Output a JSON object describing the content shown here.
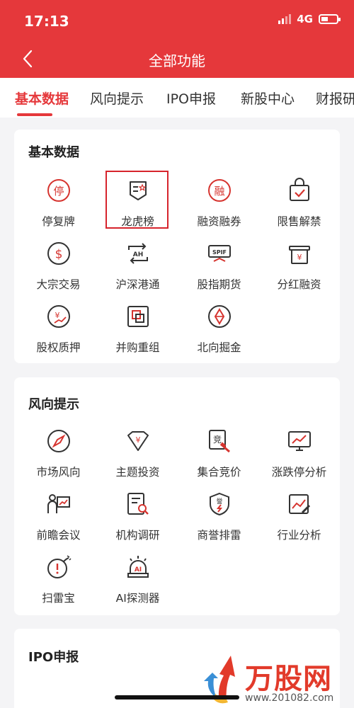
{
  "status_bar": {
    "time": "17:13",
    "network": "4G",
    "icons": [
      "signal-icon",
      "battery-icon"
    ]
  },
  "nav": {
    "back_icon": "back-arrow-icon",
    "title": "全部功能"
  },
  "tabs": [
    {
      "label": "基本数据",
      "active": true
    },
    {
      "label": "风向提示",
      "active": false
    },
    {
      "label": "IPO申报",
      "active": false
    },
    {
      "label": "新股中心",
      "active": false
    },
    {
      "label": "财报研",
      "active": false
    }
  ],
  "sections": {
    "basic": {
      "title": "基本数据",
      "items": [
        {
          "label": "停复牌",
          "icon": "suspension-icon"
        },
        {
          "label": "龙虎榜",
          "icon": "dragon-tiger-list-icon",
          "highlighted": true
        },
        {
          "label": "融资融券",
          "icon": "margin-trading-icon"
        },
        {
          "label": "限售解禁",
          "icon": "lockup-expiry-icon"
        },
        {
          "label": "大宗交易",
          "icon": "block-trade-icon"
        },
        {
          "label": "沪深港通",
          "icon": "stock-connect-icon"
        },
        {
          "label": "股指期货",
          "icon": "index-futures-icon"
        },
        {
          "label": "分红融资",
          "icon": "dividend-icon"
        },
        {
          "label": "股权质押",
          "icon": "equity-pledge-icon"
        },
        {
          "label": "并购重组",
          "icon": "merger-icon"
        },
        {
          "label": "北向掘金",
          "icon": "northbound-icon"
        }
      ]
    },
    "wind": {
      "title": "风向提示",
      "items": [
        {
          "label": "市场风向",
          "icon": "compass-icon"
        },
        {
          "label": "主题投资",
          "icon": "theme-investment-icon"
        },
        {
          "label": "集合竞价",
          "icon": "auction-icon"
        },
        {
          "label": "涨跌停分析",
          "icon": "limit-analysis-icon"
        },
        {
          "label": "前瞻会议",
          "icon": "meeting-icon"
        },
        {
          "label": "机构调研",
          "icon": "research-icon"
        },
        {
          "label": "商誉排雷",
          "icon": "goodwill-shield-icon"
        },
        {
          "label": "行业分析",
          "icon": "industry-analysis-icon"
        },
        {
          "label": "扫雷宝",
          "icon": "mine-sweeper-icon"
        },
        {
          "label": "AI探测器",
          "icon": "ai-detector-icon"
        }
      ]
    },
    "ipo": {
      "title": "IPO申报"
    }
  },
  "watermark": {
    "brand": "万股网",
    "url": "www.201082.com"
  },
  "colors": {
    "accent": "#e5383b",
    "icon_stroke": "#d6342f"
  }
}
